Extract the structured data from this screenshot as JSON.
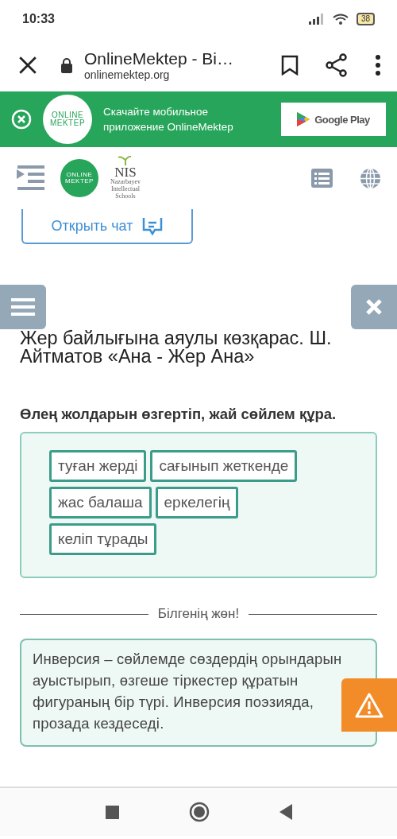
{
  "status_bar": {
    "time": "10:33",
    "battery": "38"
  },
  "browser": {
    "title": "OnlineMektep - Bi…",
    "url": "onlinemektep.org"
  },
  "banner": {
    "logo": [
      "ONLINE",
      "MEKTEP"
    ],
    "text": "Скачайте мобильное приложение OnlineMektep",
    "store_button": "Google Play"
  },
  "site_header": {
    "logo": [
      "ONLINE",
      "MEKTEP"
    ],
    "partner_logo": "NIS",
    "partner_caption": "Nazarbayev Intellectual Schools"
  },
  "chat_button": "Открыть чат",
  "lesson_title": "Жер байлығына аяулы көзқарас. Ш. Айтматов «Ана - Жер Ана»",
  "task": "Өлең жолдарын өзгертіп, жай сөйлем құра.",
  "word_chips": [
    "туған жерді",
    "сағынып жеткенде",
    "жас балаша",
    "еркелегің",
    "келіп тұрады"
  ],
  "divider_label": "Білгенің жөн!",
  "info_text": "Инверсия – сөйлемде сөздердің орындарын ауыстырып, өзгеше тіркестер құратын фигураның бір түрі. Инверсия поэзияда, прозада кездеседі."
}
